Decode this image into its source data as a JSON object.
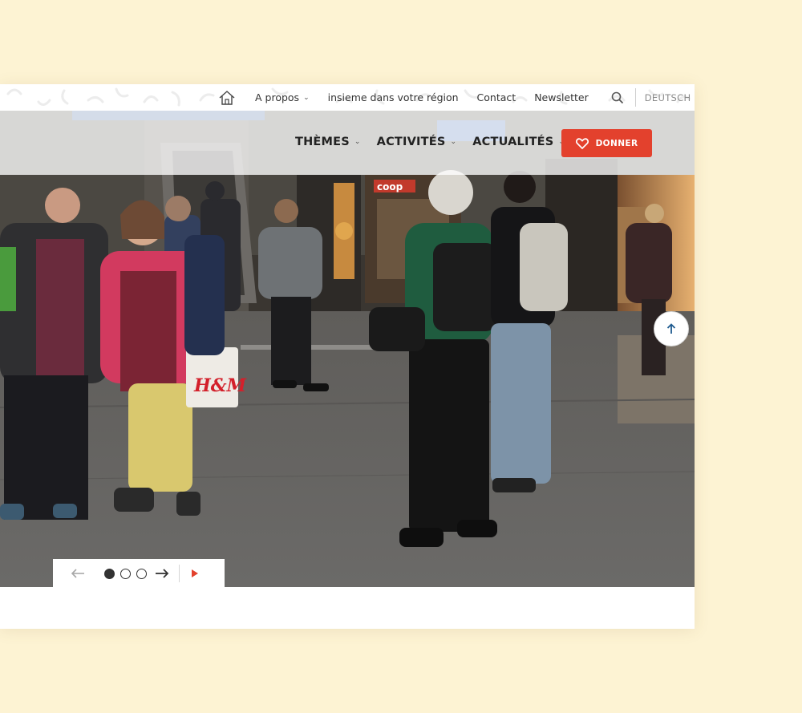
{
  "utility_nav": {
    "home_icon": "home-icon",
    "about_label": "A propos",
    "region_label": "insieme dans votre région",
    "contact_label": "Contact",
    "newsletter_label": "Newsletter",
    "search_icon": "search-icon",
    "language_label": "DEUTSCH"
  },
  "main_nav": {
    "items": [
      {
        "label": "THÈMES"
      },
      {
        "label": "ACTIVITÉS"
      },
      {
        "label": "ACTUALITÉS"
      }
    ],
    "donate_label": "DONNER",
    "donate_icon": "heart-icon"
  },
  "hero": {
    "store_sign": "coop",
    "bag_logo": "H&M"
  },
  "slider": {
    "slides_total": 3,
    "active_slide": 1
  },
  "colors": {
    "page_background": "#fdf3d3",
    "accent_red": "#e3412d",
    "scroll_top_arrow": "#1f5b8f"
  }
}
